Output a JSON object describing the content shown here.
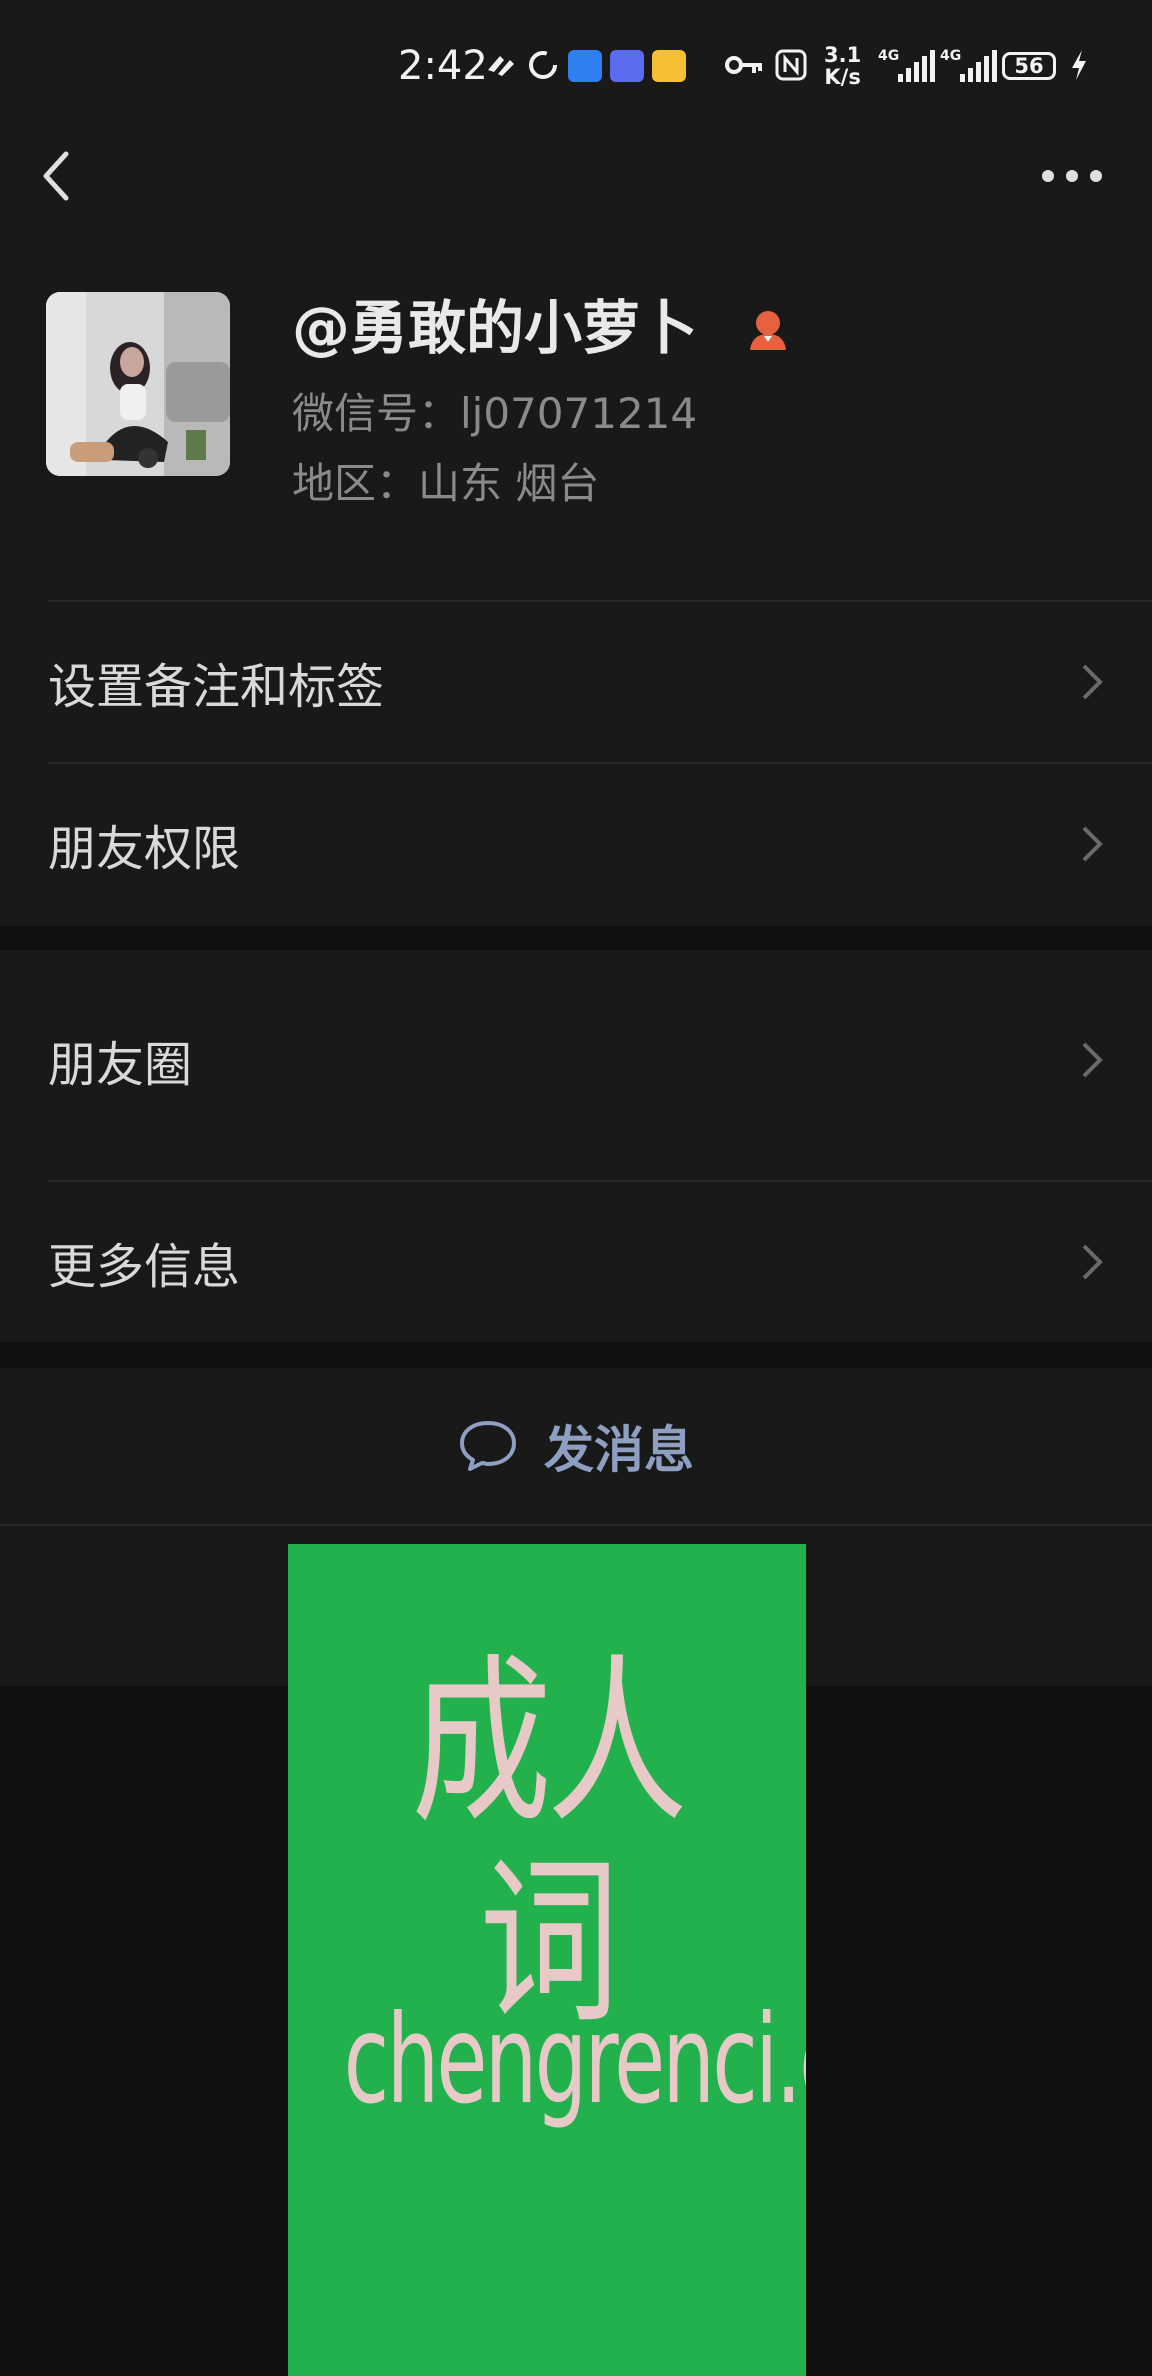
{
  "status_bar": {
    "time": "2:42",
    "network_speed_value": "3.1",
    "network_speed_unit": "K/s",
    "battery": "56",
    "signal_label_1": "4G",
    "signal_label_2": "4G"
  },
  "header": {
    "back_icon": "back-arrow-icon",
    "more_icon": "more-dots-icon"
  },
  "profile": {
    "nickname": "@勇敢的小萝卜",
    "gender_icon": "female-icon",
    "gender_color": "#e4623f",
    "wechat_id": "微信号：lj07071214",
    "region": "地区：山东  烟台"
  },
  "rows": {
    "remark_tags": "设置备注和标签",
    "friend_permissions": "朋友权限",
    "moments": "朋友圈",
    "more_info": "更多信息"
  },
  "actions": {
    "send_message": "发消息",
    "send_message_color": "#8e9fc1"
  },
  "overlay_ad": {
    "title": "成人词",
    "domain": "chengrenci.com",
    "background": "#22b14c"
  }
}
